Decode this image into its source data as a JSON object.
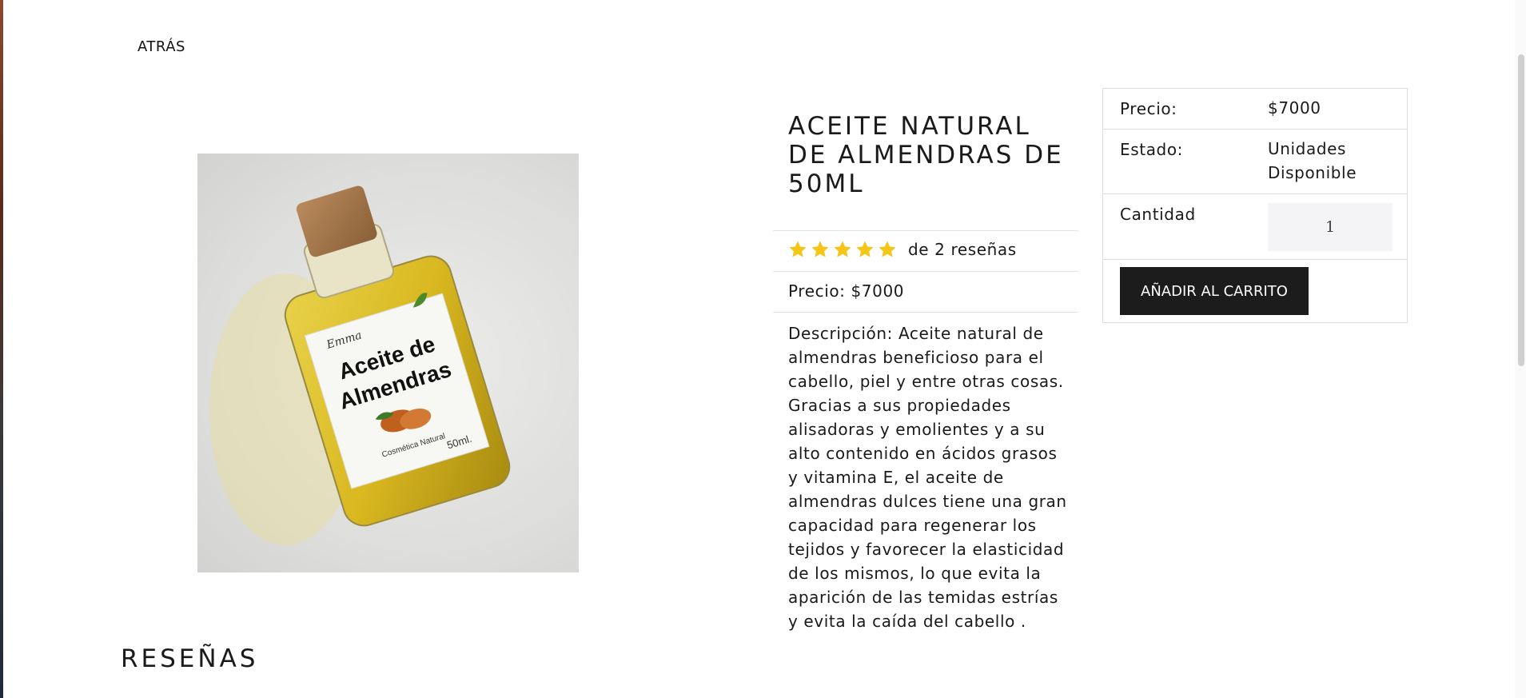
{
  "nav": {
    "back_label": "ATRÁS"
  },
  "product": {
    "title": "ACEITE NATURAL DE ALMENDRAS DE 50ML",
    "rating": {
      "stars": 5,
      "max_stars": 5,
      "reviews_text": "de 2 reseñas",
      "star_color": "#f5c518"
    },
    "price_line": "Precio: $7000",
    "description": "Descripción: Aceite natural de almendras beneficioso para el cabello, piel y entre otras cosas. Gracias a sus propiedades alisadoras y emolientes y a su alto contenido en ácidos grasos y vitamina E, el aceite de almendras dulces tiene una gran capacidad para regenerar los tejidos y favorecer la elasticidad de los mismos, lo que evita la aparición de las temidas estrías y evita la caída del cabello .",
    "image": {
      "brand": "Emma",
      "label_line1": "Aceite de",
      "label_line2": "Almendras",
      "label_small": "Cosmética Natural",
      "volume": "50ml."
    }
  },
  "buy_box": {
    "price_label": "Precio:",
    "price_value": "$7000",
    "status_label": "Estado:",
    "status_value": "Unidades Disponible",
    "quantity_label": "Cantidad",
    "quantity_value": "1",
    "add_to_cart_label": "AÑADIR AL CARRITO",
    "button_color": "#1c1c1c"
  },
  "reviews": {
    "heading": "RESEÑAS"
  }
}
